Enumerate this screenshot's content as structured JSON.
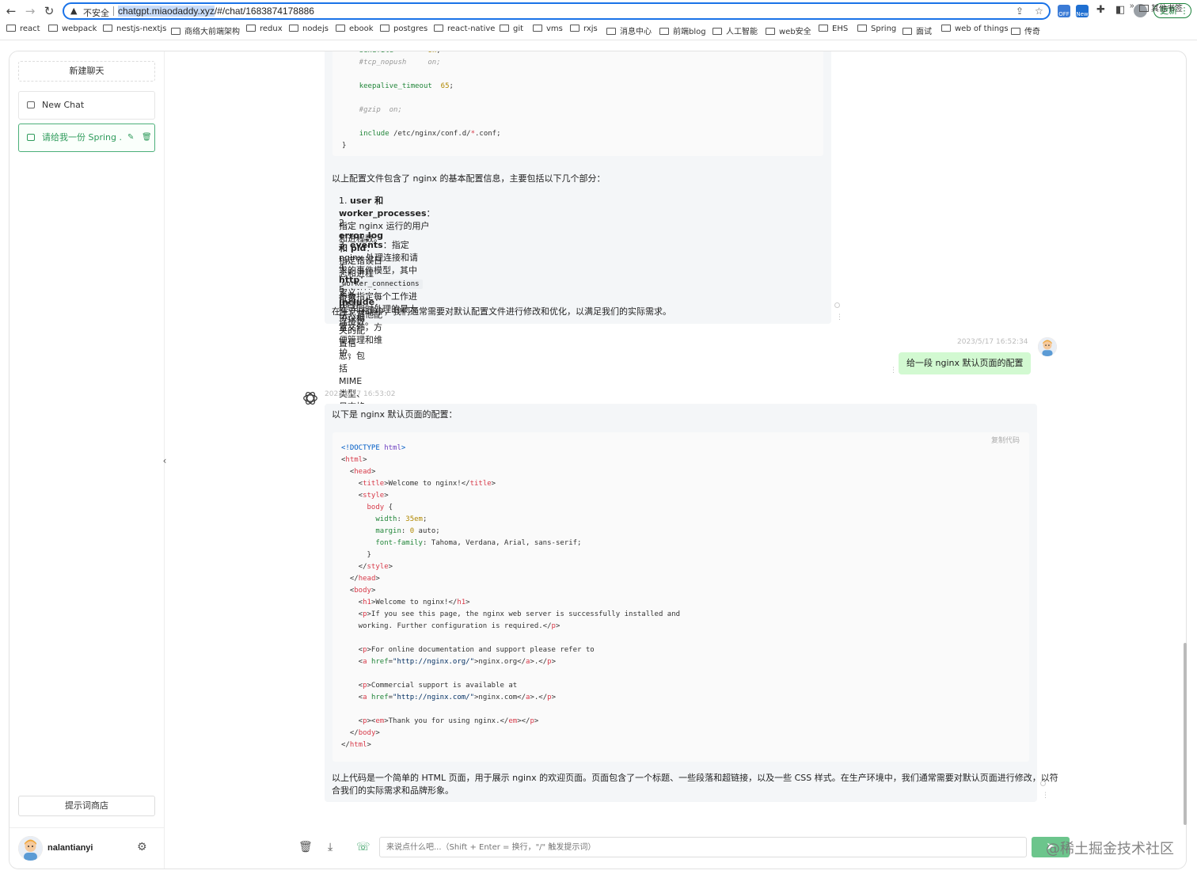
{
  "browser": {
    "security_label": "不安全",
    "url_host": "chatgpt.miaodaddy.xyz",
    "url_path": "/#/chat/1683874178886",
    "update_label": "更新",
    "extension_off_badge": "OFF",
    "extension_new_badge": "New",
    "bookmarks": [
      "react",
      "webpack",
      "nestjs-nextjs",
      "商络大前端架构",
      "redux",
      "nodejs",
      "ebook",
      "postgres",
      "react-native",
      "git",
      "vms",
      "rxjs",
      "消息中心",
      "前端blog",
      "人工智能",
      "web安全",
      "EHS",
      "Spring",
      "面试",
      "web of things",
      "传奇"
    ],
    "bookmarks_more": "»",
    "other_bookmarks": "其他书签"
  },
  "sidebar": {
    "new_chat_label": "新建聊天",
    "chats": [
      {
        "title": "New Chat"
      },
      {
        "title": "请给我一份 Spring ..."
      }
    ],
    "prompt_store_label": "提示词商店",
    "user_name": "nalantianyi"
  },
  "messages": {
    "code1": [
      "    sendfile        on;",
      "    #tcp_nopush     on;",
      "",
      "    keepalive_timeout  65;",
      "",
      "    #gzip  on;",
      "",
      "    include /etc/nginx/conf.d/*.conf;",
      "}"
    ],
    "bot1_intro": "以上配置文件包含了 nginx 的基本配置信息，主要包括以下几个部分：",
    "bot1_list": [
      {
        "num": "1.",
        "bold": "user 和 worker_processes",
        "text": "：指定 nginx 运行的用户和进程数。"
      },
      {
        "num": "2.",
        "bold": "error_log 和 pid",
        "text": "：指定错误日志和进程 ID 文件的位置。"
      },
      {
        "num": "3.",
        "bold": "events",
        "text": "：指定 nginx 处理连接和请求的事件模型，其中 ",
        "code": "worker_connections",
        "text2": " 参数指定每个工作进程可同时处理的最大连接数。"
      },
      {
        "num": "4.",
        "bold": "http",
        "text": "：定义 HTTP 协议相关的配置信息，包括 MIME 类型、日志格式、发送文件等。"
      },
      {
        "num": "5.",
        "bold": "include",
        "text": "：引入其他配置文件，方便管理和维护。"
      }
    ],
    "bot1_outro": "在生产环境中，我们通常需要对默认配置文件进行修改和优化，以满足我们的实际需求。",
    "user_time": "2023/5/17 16:52:34",
    "user_text": "给一段 nginx 默认页面的配置",
    "bot2_time": "2023/5/17 16:53:02",
    "bot2_intro": "以下是 nginx 默认页面的配置：",
    "copy_code_label": "复制代码",
    "code2": [
      "<!DOCTYPE html>",
      "<html>",
      "  <head>",
      "    <title>Welcome to nginx!</title>",
      "    <style>",
      "      body {",
      "        width: 35em;",
      "        margin: 0 auto;",
      "        font-family: Tahoma, Verdana, Arial, sans-serif;",
      "      }",
      "    </style>",
      "  </head>",
      "  <body>",
      "    <h1>Welcome to nginx!</h1>",
      "    <p>If you see this page, the nginx web server is successfully installed and",
      "    working. Further configuration is required.</p>",
      "",
      "    <p>For online documentation and support please refer to",
      "    <a href=\"http://nginx.org/\">nginx.org</a>.</p>",
      "",
      "    <p>Commercial support is available at",
      "    <a href=\"http://nginx.com/\">nginx.com</a>.</p>",
      "",
      "    <p><em>Thank you for using nginx.</em></p>",
      "  </body>",
      "</html>"
    ],
    "bot2_outro_line1": "以上代码是一个简单的 HTML 页面，用于展示 nginx 的欢迎页面。页面包含了一个标题、一些段落和超链接，以及一些 CSS 样式。在生产环境中，我们通常需要对默认页面进行修改，以符",
    "bot2_outro_line2": "合我们的实际需求和品牌形象。"
  },
  "input": {
    "placeholder": "来说点什么吧...（Shift + Enter = 换行，\"/\" 触发提示词）",
    "send_icon": "➤"
  },
  "watermark": "@稀土掘金技术社区",
  "colors": {
    "accent": "#2e9b5b",
    "user_bubble": "#d2f9d1",
    "bot_bubble": "#f4f6f8",
    "url_focus": "#1a73e8"
  }
}
